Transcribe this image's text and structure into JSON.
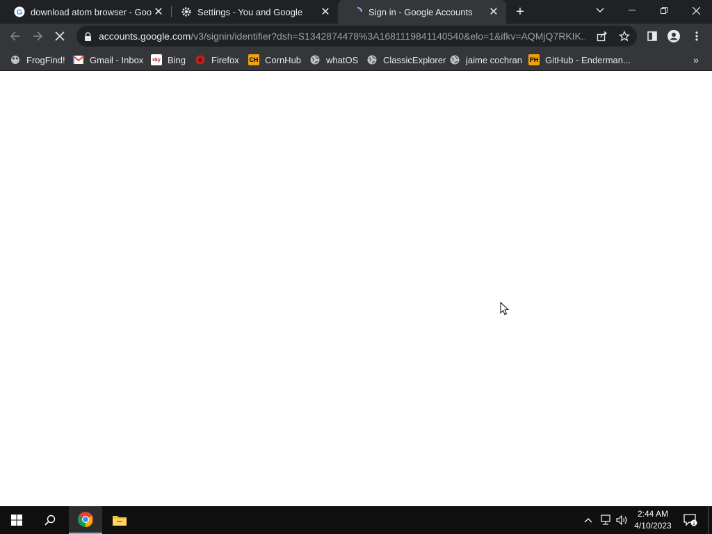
{
  "tabs": [
    {
      "title": "download atom browser - Google Search",
      "favicon": "google-g-icon",
      "active": false
    },
    {
      "title": "Settings - You and Google",
      "favicon": "gear-icon",
      "active": false
    },
    {
      "title": "Sign in - Google Accounts",
      "favicon": "loading-spinner-icon",
      "active": true
    }
  ],
  "window_controls": [
    "tab-search-icon",
    "minimize-icon",
    "restore-icon",
    "close-icon"
  ],
  "omnibox": {
    "host": "accounts.google.com",
    "path": "/v3/signin/identifier?dsh=S1342874478%3A1681119841140540&elo=1&ifkv=AQMjQ7RKIK..."
  },
  "bookmarks": [
    {
      "label": "FrogFind!",
      "icon": "frog-icon"
    },
    {
      "label": "Gmail - Inbox",
      "icon": "gmail-icon"
    },
    {
      "label": "Bing",
      "icon": "sky-icon"
    },
    {
      "label": "Firefox",
      "icon": "firefox-icon"
    },
    {
      "label": "CornHub",
      "icon": "ch-icon"
    },
    {
      "label": "whatOS",
      "icon": "globe-icon"
    },
    {
      "label": "ClassicExplorer",
      "icon": "globe-icon"
    },
    {
      "label": "jaime cochran",
      "icon": "globe-icon"
    },
    {
      "label": "GitHub - Enderman...",
      "icon": "ph-icon"
    }
  ],
  "taskbar": {
    "time": "2:44 AM",
    "date": "4/10/2023",
    "notifications": "1"
  },
  "colors": {
    "tabstrip": "#202124",
    "toolbar": "#35363a",
    "text": "#e8eaed",
    "taskbar": "#101010"
  }
}
